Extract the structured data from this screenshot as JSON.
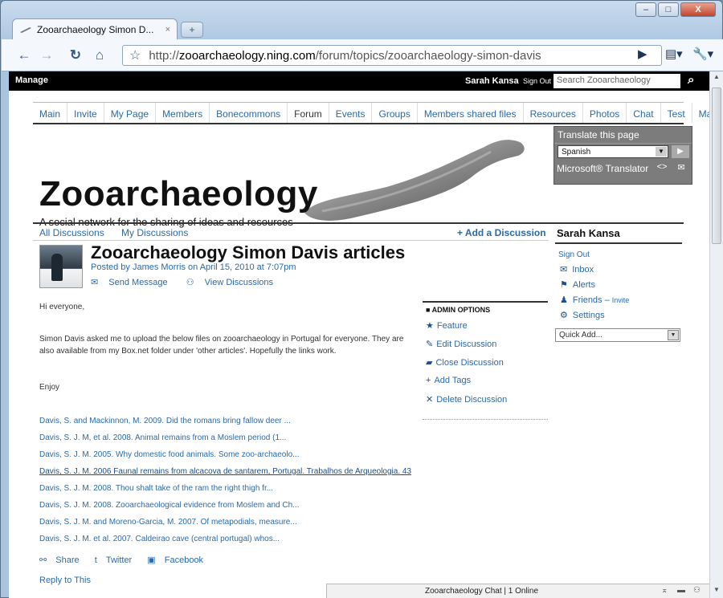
{
  "browser": {
    "tab_title": "Zooarchaeology Simon D...",
    "tab_close": "×",
    "url_protocol": "http://",
    "url_host": "zooarchaeology.ning.com",
    "url_path": "/forum/topics/zooarchaeology-simon-davis",
    "window_controls": [
      "–",
      "□",
      "X"
    ]
  },
  "ningbar": {
    "manage": "Manage",
    "user": "Sarah Kansa",
    "sign_out": "Sign Out",
    "search_placeholder": "Search Zooarchaeology"
  },
  "nav": [
    "Main",
    "Invite",
    "My Page",
    "Members",
    "Bonecommons",
    "Forum",
    "Events",
    "Groups",
    "Members shared files",
    "Resources",
    "Photos",
    "Chat",
    "Test",
    "Manage"
  ],
  "nav_active": "Forum",
  "site": {
    "name": "Zooarchaeology",
    "tagline": "A social network for the sharing of ideas and resources"
  },
  "translate": {
    "header": "Translate this page",
    "language": "Spanish",
    "brand": "Microsoft® Translator"
  },
  "subnav": {
    "all": "All Discussions",
    "mine": "My Discussions",
    "add": "+ Add a Discussion"
  },
  "post": {
    "title": "Zooarchaeology Simon Davis articles",
    "posted": "Posted by James Morris on April 15, 2010 at 7:07pm",
    "send_message": "Send Message",
    "view_discussions": "View Discussions",
    "greeting": "Hi everyone,",
    "para": "Simon Davis asked me to upload the below files on zooarchaeology in Portugal for everyone. They are also available from my Box.net folder under 'other articles'. Hopefully the links work.",
    "enjoy": "Enjoy",
    "links": [
      "Davis, S. and Mackinnon, M. 2009. Did the romans bring fallow deer ...",
      "Davis, S. J. M, et al. 2008. Animal remains from a Moslem period (1...",
      "Davis, S. J. M. 2005. Why domestic food animals. Some zoo-archaeolo...",
      "Davis, S. J. M. 2006 Faunal remains from alcacova de santarem, Portugal. Trabalhos de Arqueologia. 43",
      "Davis, S. J. M. 2008. Thou shalt take of the ram the right thigh fr...",
      "Davis, S. J. M. 2008. Zooarchaeological evidence from Moslem and Ch...",
      "Davis, S. J. M. and Moreno-Garcia, M. 2007. Of metapodials, measure...",
      "Davis, S. J. M. et al. 2007. Caldeirao cave (central portugal) whos..."
    ],
    "share": "Share",
    "twitter": "Twitter",
    "facebook": "Facebook",
    "cut_text": "Reply to This"
  },
  "admin": {
    "header": "ADMIN OPTIONS",
    "items": [
      "Feature",
      "Edit Discussion",
      "Close Discussion",
      "Add Tags",
      "Delete Discussion"
    ]
  },
  "sidebar": {
    "name": "Sarah Kansa",
    "sign_out": "Sign Out",
    "inbox": "Inbox",
    "alerts": "Alerts",
    "friends": "Friends –",
    "invite": "Invite",
    "settings": "Settings",
    "quick_add": "Quick Add..."
  },
  "chatbar": {
    "text": "Zooarchaeology Chat | 1 Online"
  }
}
